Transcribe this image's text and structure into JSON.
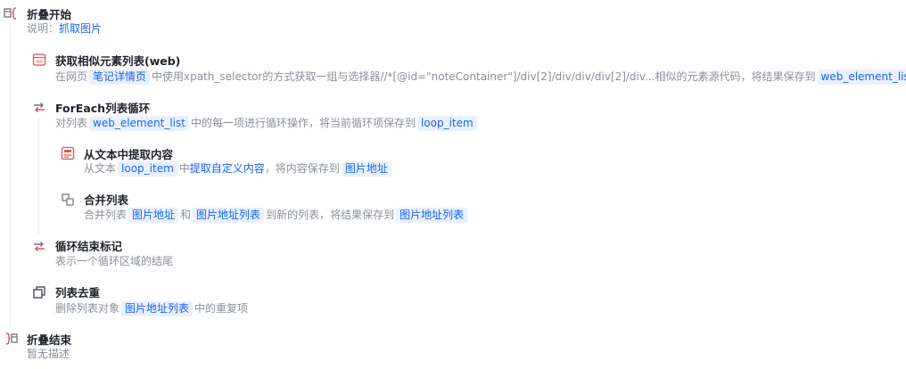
{
  "colors": {
    "accent": "#1664ff",
    "tag_bg": "#e9f1fd",
    "fold_icon": "#e2544c"
  },
  "steps": [
    {
      "title": "折叠开始",
      "icon": "fold-start-icon",
      "desc": {
        "label": "说明：",
        "value": "抓取图片"
      }
    },
    {
      "title": "获取相似元素列表(web)",
      "icon": "web-page-icon",
      "desc": {
        "p1": "在网页",
        "page": "笔记详情页",
        "p2": "中使用xpath_selector的方式获取一组与选择器//*[@id=\"noteContainer\"]/div[2]/div/div/div[2]/div...相似的元素源代码，将结果保存到",
        "var": "web_element_list"
      }
    },
    {
      "title": "ForEach列表循环",
      "icon": "loop-icon",
      "desc": {
        "p1": "对列表",
        "list": "web_element_list",
        "p2": "中的每一项进行循环操作，将当前循环项保存到",
        "item": "loop_item"
      }
    },
    {
      "title": "从文本中提取内容",
      "icon": "text-extract-icon",
      "desc": {
        "p1": "从文本",
        "src": "loop_item",
        "p2": "中",
        "mode": "提取自定义内容",
        "p3": "，将内容保存到",
        "dst": "图片地址"
      }
    },
    {
      "title": "合并列表",
      "icon": "merge-list-icon",
      "desc": {
        "p1": "合并列表",
        "a": "图片地址",
        "p2": "和",
        "b": "图片地址列表",
        "p3": "到新的列表，将结果保存到",
        "dst": "图片地址列表"
      }
    },
    {
      "title": "循环结束标记",
      "icon": "loop-end-icon",
      "desc": {
        "text": "表示一个循环区域的结尾"
      }
    },
    {
      "title": "列表去重",
      "icon": "dedupe-icon",
      "desc": {
        "p1": "删除列表对象",
        "list": "图片地址列表",
        "p2": "中的重复项"
      }
    },
    {
      "title": "折叠结束",
      "icon": "fold-end-icon",
      "desc": {
        "text": "暂无描述"
      }
    }
  ]
}
